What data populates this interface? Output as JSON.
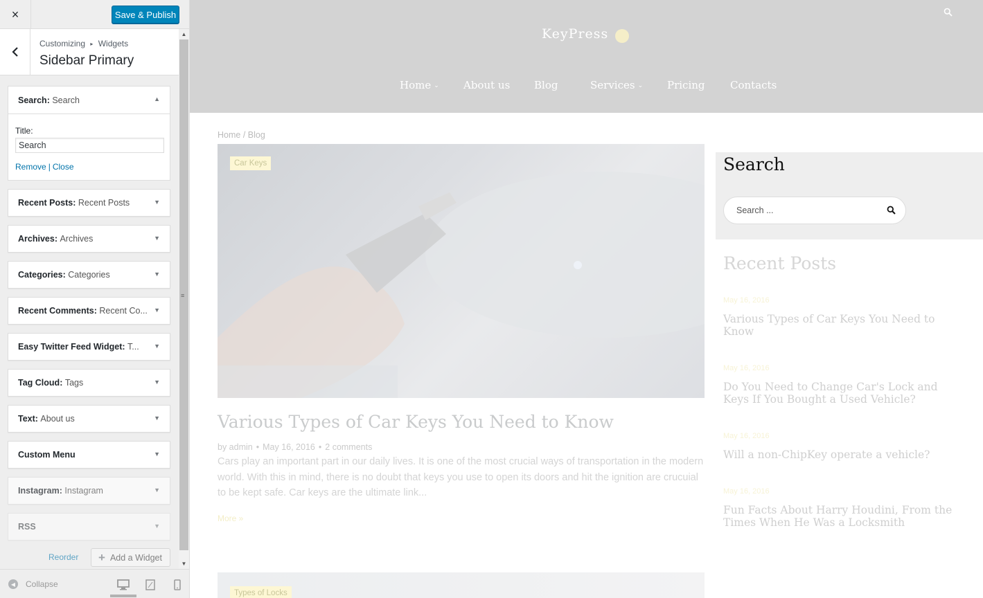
{
  "customizer": {
    "close_label": "×",
    "save_publish_label": "Save & Publish",
    "breadcrumb": {
      "root": "Customizing",
      "separator": "▸",
      "parent": "Widgets"
    },
    "section_title": "Sidebar Primary",
    "search_widget": {
      "name": "Search",
      "subtitle": "Search",
      "field_label": "Title:",
      "field_value": "Search",
      "remove_link": "Remove",
      "separator": "|",
      "close_link": "Close"
    },
    "widgets": [
      {
        "name": "Recent Posts",
        "subtitle": "Recent Posts"
      },
      {
        "name": "Archives",
        "subtitle": "Archives"
      },
      {
        "name": "Categories",
        "subtitle": "Categories"
      },
      {
        "name": "Recent Comments",
        "subtitle": "Recent Co..."
      },
      {
        "name": "Easy Twitter Feed Widget",
        "subtitle": "T..."
      },
      {
        "name": "Tag Cloud",
        "subtitle": "Tags"
      },
      {
        "name": "Text",
        "subtitle": "About us"
      },
      {
        "name": "Custom Menu",
        "subtitle": ""
      },
      {
        "name": "Instagram",
        "subtitle": "Instagram"
      },
      {
        "name": "RSS",
        "subtitle": ""
      }
    ],
    "reorder_label": "Reorder",
    "add_widget_label": "Add a Widget",
    "collapse_label": "Collapse",
    "accent_color": "#0085ba",
    "link_color": "#0073aa"
  },
  "preview": {
    "site_name": "KeyPress",
    "nav": [
      {
        "label": "Home",
        "has_submenu": true
      },
      {
        "label": "About us",
        "has_submenu": false
      },
      {
        "label": "Blog",
        "has_submenu": false
      },
      {
        "label": "Services",
        "has_submenu": true
      },
      {
        "label": "Pricing",
        "has_submenu": false
      },
      {
        "label": "Contacts",
        "has_submenu": false
      }
    ],
    "breadcrumb": "Home / Blog",
    "post": {
      "category": "Car Keys",
      "title": "Various Types of Car Keys You Need to Know",
      "author": "by admin",
      "date": "May 16, 2016",
      "comments": "2 comments",
      "excerpt": "Cars play an important part in our daily lives. It is one of the most crucial ways of transportation in the modern world. With this in mind, there is no doubt that keys you use to open its doors and hit the ignition are crucuial to be kept safe. Car keys are the ultimate link...",
      "more": "More »"
    },
    "post2_category": "Types of Locks",
    "search_widget": {
      "title": "Search",
      "placeholder": "Search ..."
    },
    "recent_posts": {
      "title": "Recent Posts",
      "items": [
        {
          "date": "May 16, 2016",
          "title": "Various Types of Car Keys You Need to Know"
        },
        {
          "date": "May 16, 2016",
          "title": "Do You Need to Change Car's Lock and Keys If You Bought a Used Vehicle?"
        },
        {
          "date": "May 16, 2016",
          "title": "Will a non-ChipKey operate a vehicle?"
        },
        {
          "date": "May 16, 2016",
          "title": "Fun Facts About Harry Houdini, From the Times When He Was a Locksmith"
        }
      ]
    }
  }
}
